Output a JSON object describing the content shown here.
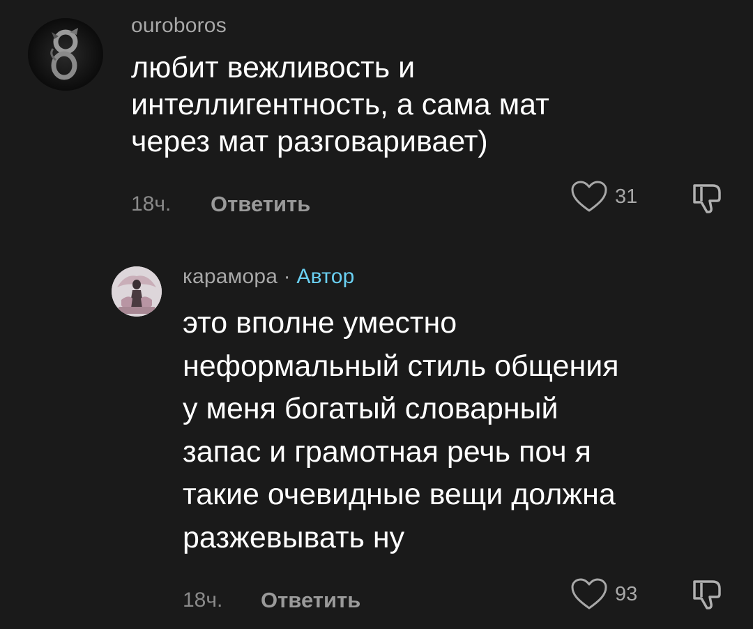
{
  "comments": [
    {
      "username": "ouroboros",
      "lines": [
        "любит вежливость и",
        "интеллигентность, а сама мат",
        "через мат разговаривает)"
      ],
      "time": "18ч.",
      "reply_label": "Ответить",
      "likes": "31",
      "avatar_icon": "ouroboros-avatar"
    },
    {
      "username": "карамора",
      "separator": "·",
      "author_badge": "Автор",
      "lines": [
        "это вполне уместно",
        "неформальный стиль общения",
        "у меня богатый словарный",
        "запас и грамотная речь поч я",
        "такие очевидные вещи должна",
        "разжевывать ну"
      ],
      "time": "18ч.",
      "reply_label": "Ответить",
      "likes": "93",
      "avatar_icon": "karamora-avatar"
    }
  ],
  "colors": {
    "background": "#1a1a1a",
    "text": "#ffffff",
    "muted": "#a8a8a8",
    "author_badge": "#6ad0f2"
  }
}
